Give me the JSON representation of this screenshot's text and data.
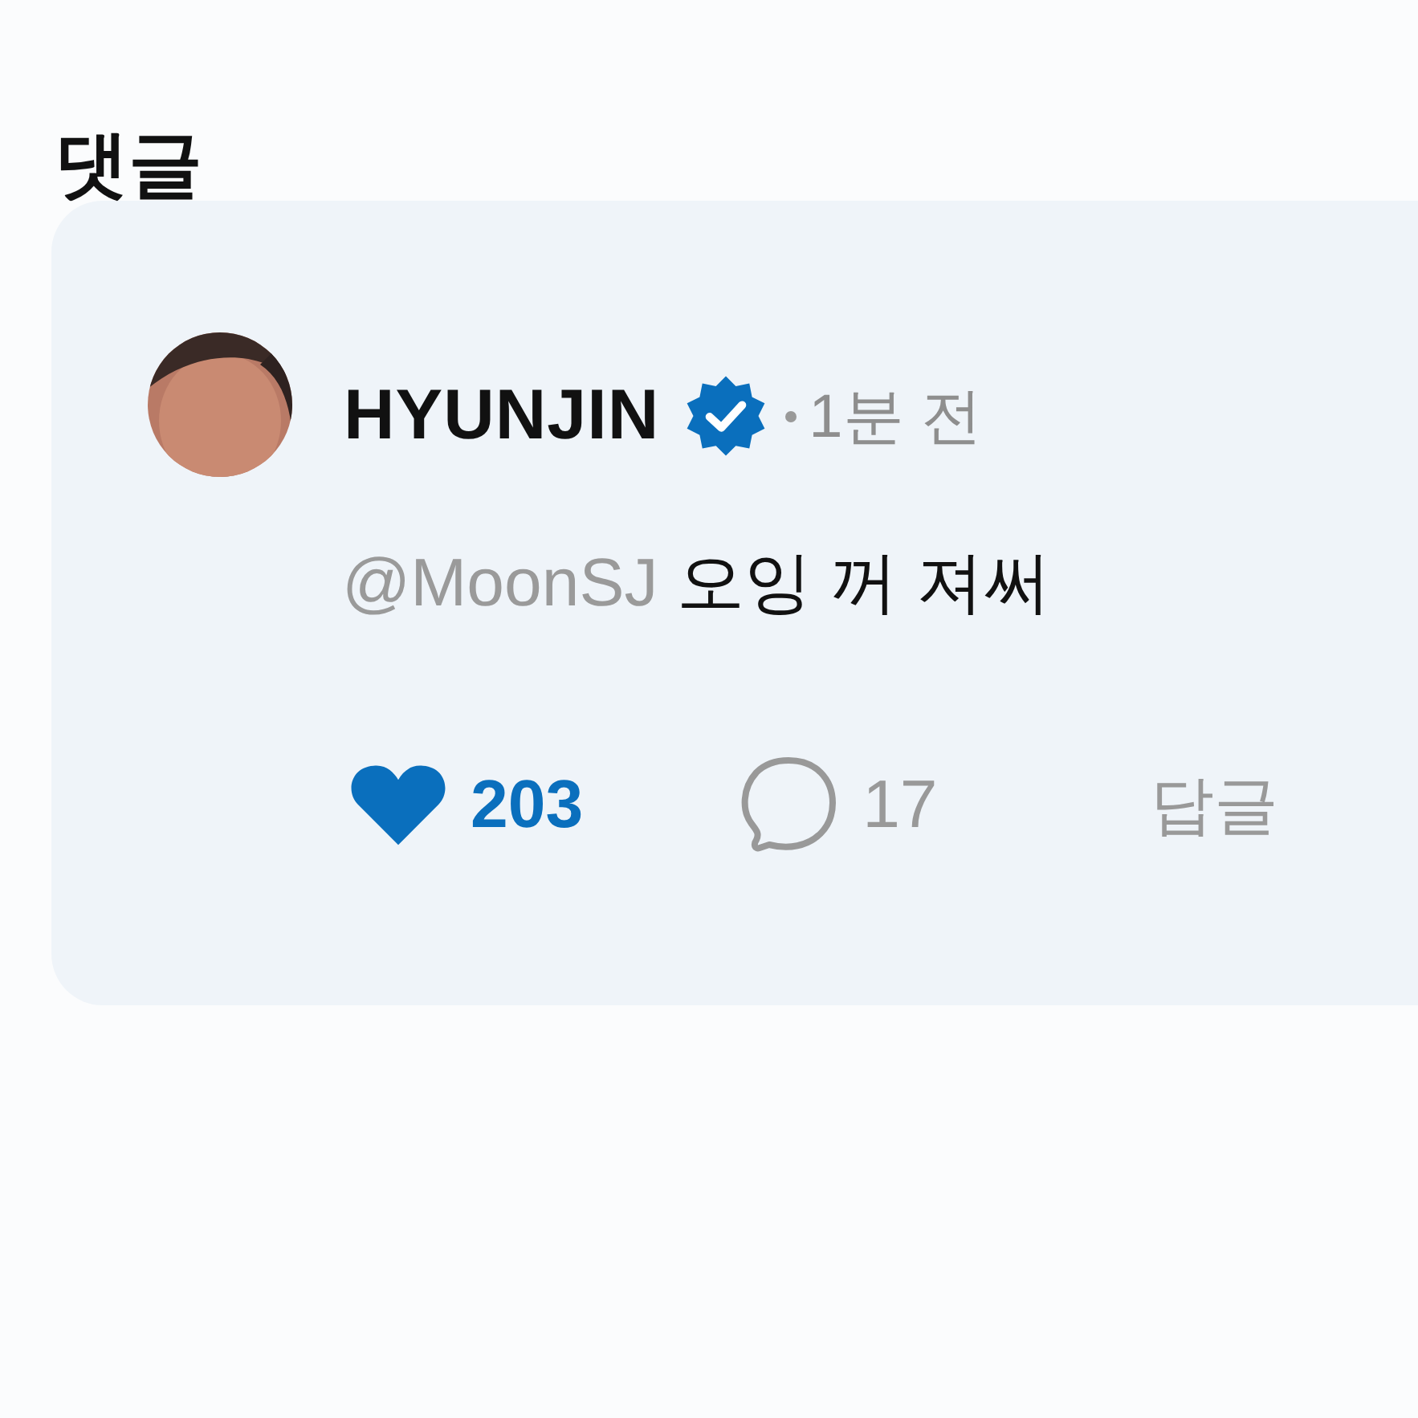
{
  "section_title": "댓글",
  "comment": {
    "author": "HYUNJIN",
    "verified": true,
    "time": "1분 전",
    "mention": "@MoonSJ",
    "text": "오잉 꺼 져써",
    "like": {
      "count": "203",
      "liked": true
    },
    "replies": {
      "count": "17"
    },
    "reply_label": "답글"
  }
}
